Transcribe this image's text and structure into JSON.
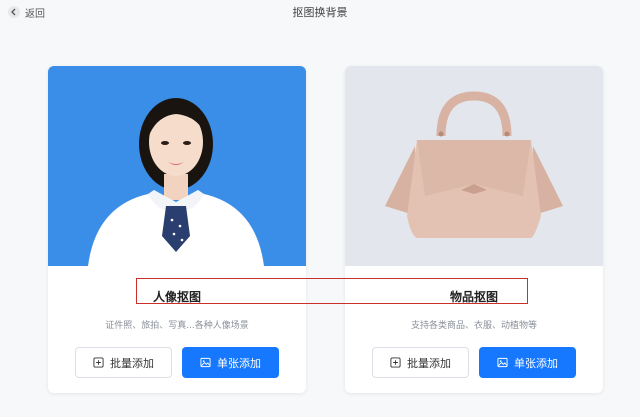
{
  "header": {
    "back_label": "返回",
    "title": "抠图换背景"
  },
  "cards": [
    {
      "title": "人像抠图",
      "description": "证件照、旅拍、写真...各种人像场景",
      "image_bg": "#3b8ee8",
      "batch_label": "批量添加",
      "single_label": "单张添加"
    },
    {
      "title": "物品抠图",
      "description": "支持各类商品、衣服、动植物等",
      "image_bg": "#e3e7ed",
      "batch_label": "批量添加",
      "single_label": "单张添加"
    }
  ],
  "colors": {
    "primary": "#1677ff",
    "highlight": "#c9302c"
  }
}
